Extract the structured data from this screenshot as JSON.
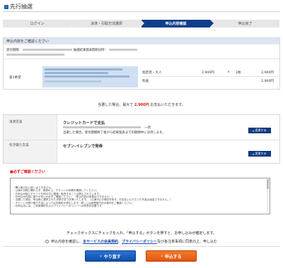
{
  "page": {
    "title": "先行抽選"
  },
  "steps": [
    {
      "label": "ログイン"
    },
    {
      "label": "決済・引取方法選択"
    },
    {
      "label": "申込内容確認"
    },
    {
      "label": "申込完了"
    }
  ],
  "confirm": {
    "header": "申込内容をご確認ください",
    "reception_label": "受付期間：",
    "result_label": "抽選結果発表開始日時：",
    "choice_label": "第1希望",
    "seat_type": "指定席・大人",
    "unit_price": "2,900円",
    "times": "×",
    "quantity": "1枚",
    "subtotal": "2,900円",
    "fee_label": "料金",
    "fee_total": "2,900円"
  },
  "max_charge": {
    "prefix": "当選した場合、最大で",
    "amount": "2,900円",
    "suffix": "お支払いただきます。"
  },
  "payment": {
    "label": "決済方法",
    "method": "クレジットカードで支払",
    "count": "一括",
    "note": "当選した場合、受付期間終了後から結果発表までの期間中に決済します。",
    "change_label": "変更する"
  },
  "pickup": {
    "label": "引き取り方法",
    "method": "セブン-イレブンで発券",
    "change_label": "変更する"
  },
  "notice": {
    "title": "■必ずご確認ください",
    "text": "・購入後の払い戻しはできません。\n・公演の日程に関わらず、発券の上、チケットの到着を確認してください。\n・お申込み後にチケットを他の方に譲渡・転売することは禁止されています。\n・お申込み内容に誤りがないか必ずご確認ください。（申込内容の変更はできません。）\n・当選した場合、申込時に選択された決済方法で決済いたします。（公演中止の場合を除き、お支払いいただいた代金は返金できません。）\n・チケットの受け取り方法によっては手数料が発生します。詳しくは各受取方法の案内をご確認ください。\n・お申込みには、ご利用規約およびプライバシーポリシーへの同意が必要です。"
  },
  "instruction": "チェックボックスにチェックを入れ、「申込する」ボタンを押すと、お申し込みが確定します。",
  "agree": {
    "prefix": "申込内容を確認し、",
    "link1": "本サービスの会員規約",
    "sep": "、",
    "link2": "プライバシーポリシー",
    "suffix": "及び各注意事項に同意の上、申し込む"
  },
  "buttons": {
    "back": "やり直す",
    "apply": "申込する"
  },
  "colors": {
    "step_active": "#0e3f8a",
    "apply": "#e35510",
    "back": "#0f4fa8",
    "price": "#d11111"
  }
}
